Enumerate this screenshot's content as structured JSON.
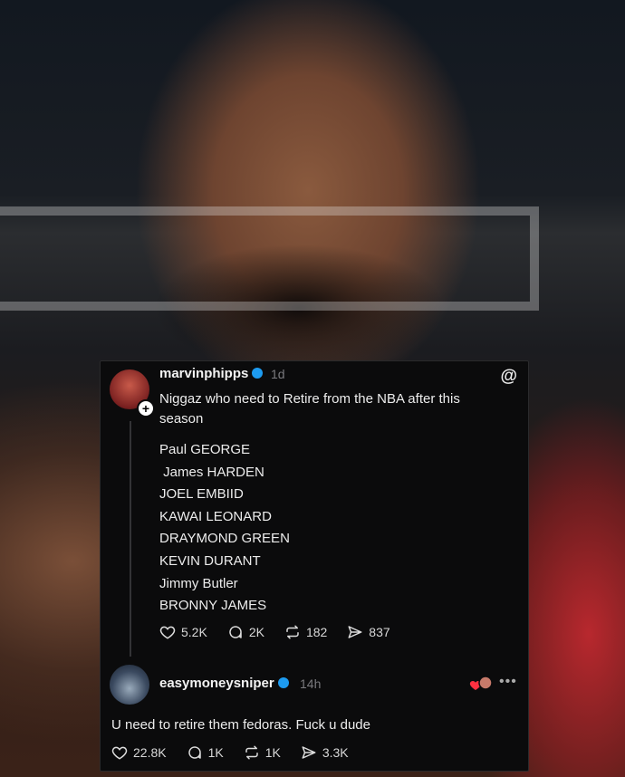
{
  "background": {
    "brand_text": ""
  },
  "post": {
    "username": "marvinphipps",
    "time": "1d",
    "text": "Niggaz who need to Retire from the NBA after this season",
    "names": [
      "Paul GEORGE",
      " James HARDEN",
      "JOEL EMBIID",
      "KAWAI LEONARD",
      "DRAYMOND GREEN",
      "KEVIN DURANT",
      "Jimmy Butler",
      "BRONNY JAMES"
    ],
    "stats": {
      "likes": "5.2K",
      "comments": "2K",
      "reposts": "182",
      "shares": "837"
    }
  },
  "reply": {
    "username": "easymoneysniper",
    "time": "14h",
    "text": "U need to retire them fedoras. Fuck u dude",
    "stats": {
      "likes": "22.8K",
      "comments": "1K",
      "reposts": "1K",
      "shares": "3.3K"
    }
  },
  "icons": {
    "threads": "threads-logo-icon",
    "verified": "verified-badge-icon",
    "like": "heart-icon",
    "comment": "comment-bubble-icon",
    "repost": "repost-icon",
    "share": "send-icon",
    "more": "more-options-icon"
  },
  "colors": {
    "verified": "#1d9bf0",
    "card_bg": "#0b0b0c",
    "muted": "#7a7a7e",
    "jersey": "#b8282e"
  }
}
